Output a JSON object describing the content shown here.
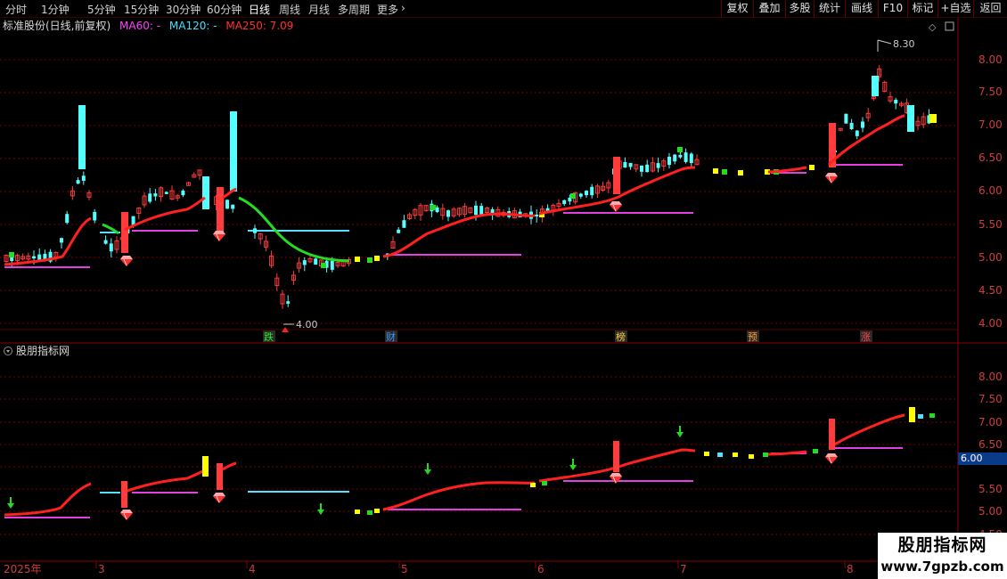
{
  "toolbar": {
    "timeframes": [
      "分时",
      "1分钟",
      "5分钟",
      "15分钟",
      "30分钟",
      "60分钟",
      "日线",
      "周线",
      "月线",
      "多周期",
      "更多"
    ],
    "active_timeframe": "日线",
    "more_chevron": "›",
    "right_buttons": [
      "复权",
      "叠加",
      "多股",
      "统计",
      "画线",
      "F10",
      "标记",
      "+自选",
      "返回"
    ]
  },
  "main_panel": {
    "title": "标准股份(日线,前复权)",
    "ma60_label": "MA60: -",
    "ma120_label": "MA120: -",
    "ma250_label": "MA250: 7.09",
    "high_marker": "8.30",
    "low_marker": "4.00",
    "y_ticks": [
      "8.00",
      "7.50",
      "7.00",
      "6.50",
      "6.00",
      "5.50",
      "5.00",
      "4.50",
      "4.00"
    ],
    "event_markers": [
      "跌",
      "财",
      "榜",
      "预",
      "涨"
    ]
  },
  "indicator_panel": {
    "title": "股朋指标网",
    "y_ticks": [
      "8.00",
      "7.50",
      "7.00",
      "6.50",
      "5.50",
      "5.00",
      "4.50"
    ],
    "current_value": "6.00"
  },
  "time_axis": {
    "labels": [
      "2025年",
      "3",
      "4",
      "5",
      "6",
      "7",
      "8"
    ]
  },
  "watermark": {
    "line1": "股朋指标网",
    "line2": "www.7gpzb.com"
  },
  "colors": {
    "up": "#ff3b3b",
    "down": "#54ffff",
    "ma_red": "#ff2020",
    "ma_green": "#22dd22",
    "support_magenta": "#e040e0",
    "support_cyan": "#55e0ff",
    "highlight_yellow": "#ffff00",
    "grid": "#7a0000",
    "axis_text": "#d03c3c"
  }
}
